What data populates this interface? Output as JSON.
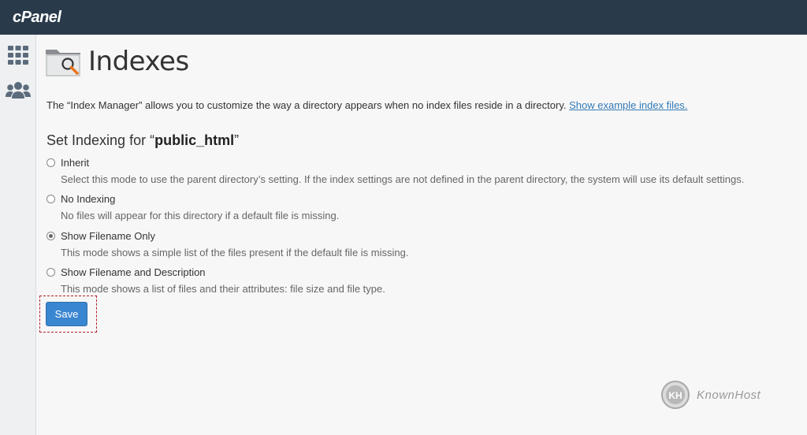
{
  "topbar": {
    "logo": "cPanel"
  },
  "sidebar": {
    "items": [
      {
        "icon": "grid-icon"
      },
      {
        "icon": "users-icon"
      }
    ]
  },
  "page": {
    "title": "Indexes",
    "description": "The “Index Manager” allows you to customize the way a directory appears when no index files reside in a directory.",
    "example_link": "Show example index files.",
    "set_prefix": "Set Indexing for “",
    "directory": "public_html",
    "set_suffix": "”"
  },
  "options": [
    {
      "label": "Inherit",
      "description": "Select this mode to use the parent directory’s setting. If the index settings are not defined in the parent directory, the system will use its default settings.",
      "checked": false
    },
    {
      "label": "No Indexing",
      "description": "No files will appear for this directory if a default file is missing.",
      "checked": false
    },
    {
      "label": "Show Filename Only",
      "description": "This mode shows a simple list of the files present if the default file is missing.",
      "checked": true
    },
    {
      "label": "Show Filename and Description",
      "description": "This mode shows a list of files and their attributes: file size and file type.",
      "checked": false
    }
  ],
  "save_label": "Save",
  "watermark": "KnownHost",
  "colors": {
    "topbar": "#293a4a",
    "accent": "#3a86d0",
    "highlight": "#b31d2b",
    "link": "#337ab7"
  }
}
